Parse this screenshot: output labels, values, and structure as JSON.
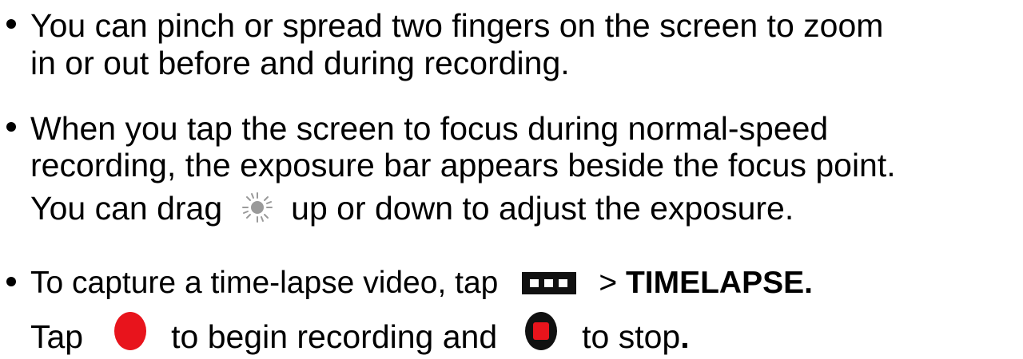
{
  "bullets": [
    {
      "lines": [
        "You can pinch or spread two fingers on the screen to zoom",
        "in or out before and during recording."
      ]
    },
    {
      "lines": [
        "When you tap the screen to focus during normal-speed",
        "recording, the exposure bar appears beside the focus point."
      ],
      "continuation": {
        "before": "You can drag",
        "icon": "exposure-sun-icon",
        "after": "up or down to adjust the exposure."
      }
    },
    {
      "line": {
        "before": "To capture a time-lapse video, tap",
        "icon": "more-options-icon",
        "arrow": ">",
        "bold": "TIMELAPSE."
      },
      "continuation": {
        "tap": "Tap",
        "record_icon": "record-button-icon",
        "middle": "to begin recording and",
        "stop_icon": "stop-button-icon",
        "after": "to stop",
        "end": "."
      }
    }
  ],
  "colors": {
    "text": "#000000",
    "record": "#e8141c",
    "stop_outer": "#111111",
    "stop_inner": "#e8141c",
    "sun": "#9a9a9a"
  }
}
